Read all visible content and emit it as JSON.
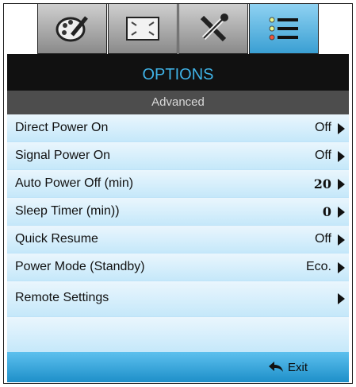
{
  "tabs": [
    {
      "name": "display",
      "icon": "palette-icon"
    },
    {
      "name": "image",
      "icon": "screen-frame-icon"
    },
    {
      "name": "setup",
      "icon": "tools-icon"
    },
    {
      "name": "options",
      "icon": "list-menu-icon",
      "active": true
    }
  ],
  "header": {
    "title": "OPTIONS",
    "subtitle": "Advanced"
  },
  "rows": [
    {
      "label": "Direct Power On",
      "value": "Off"
    },
    {
      "label": "Signal Power On",
      "value": "Off"
    },
    {
      "label": "Auto Power Off (min)",
      "value": "20"
    },
    {
      "label": "Sleep Timer (min))",
      "value": "0"
    },
    {
      "label": "Quick Resume",
      "value": "Off"
    },
    {
      "label": "Power Mode (Standby)",
      "value": "Eco."
    },
    {
      "label": "Remote Settings",
      "value": ""
    }
  ],
  "footer": {
    "exit_label": "Exit",
    "exit_icon": "return-arrow-icon"
  },
  "colors": {
    "accent": "#3fb2e6",
    "row_bg": "#d6eefb",
    "title_bg": "#111111",
    "subtitle_bg": "#4d4d4d"
  }
}
